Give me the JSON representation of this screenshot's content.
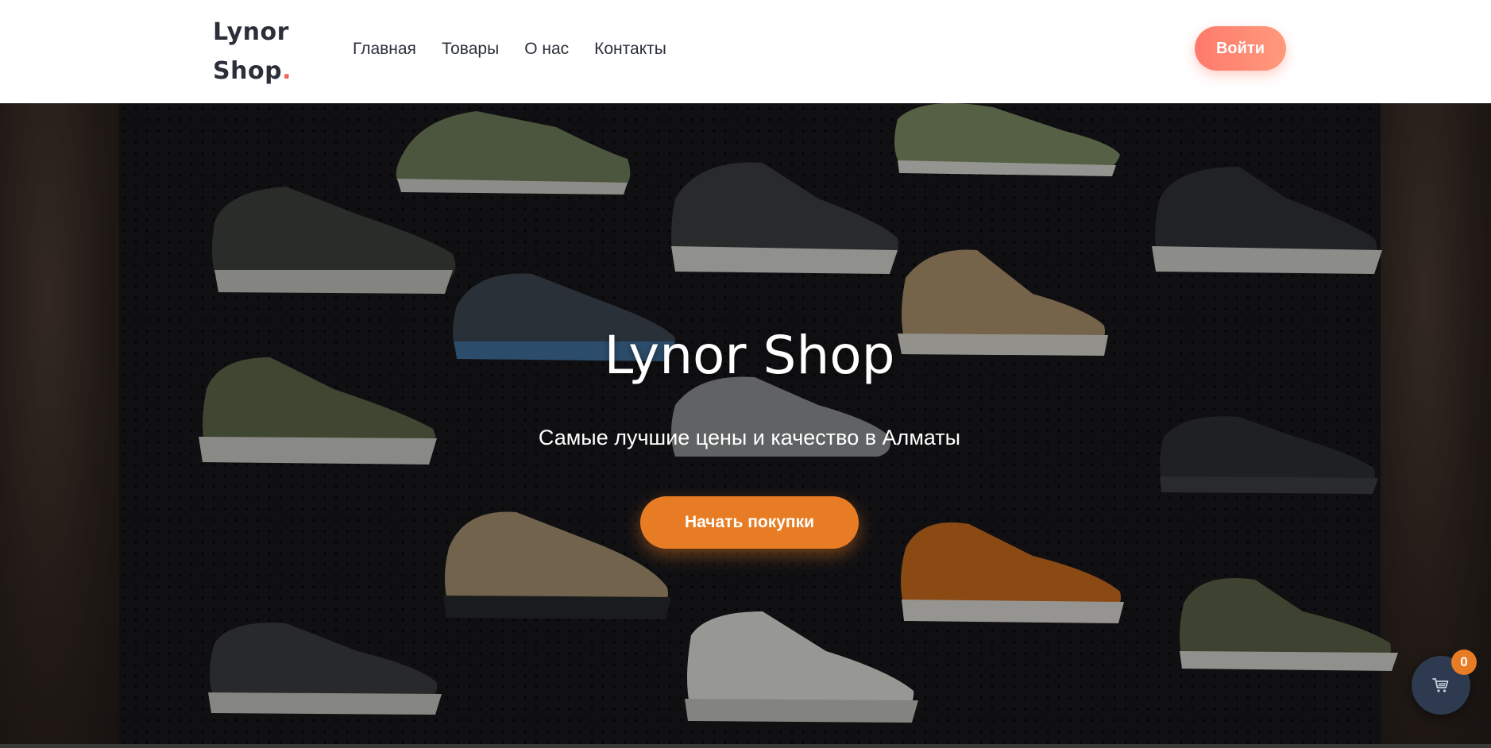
{
  "header": {
    "logo_line1": "Lynor",
    "logo_line2": "Shop",
    "logo_dot": ".",
    "nav": [
      "Главная",
      "Товары",
      "О нас",
      "Контакты"
    ],
    "login_label": "Войти"
  },
  "hero": {
    "title": "Lynor Shop",
    "subtitle": "Самые лучшие цены и качество в Алматы",
    "cta_label": "Начать покупки"
  },
  "cart": {
    "count": "0"
  },
  "colors": {
    "accent_orange": "#e87c24",
    "login_gradient_start": "#ff7a6c",
    "logo_dot": "#f0625a",
    "text_dark": "#2b2f3a",
    "cart_fab": "#2d3a4f"
  },
  "icons": {
    "cart": "shopping-cart-icon"
  }
}
